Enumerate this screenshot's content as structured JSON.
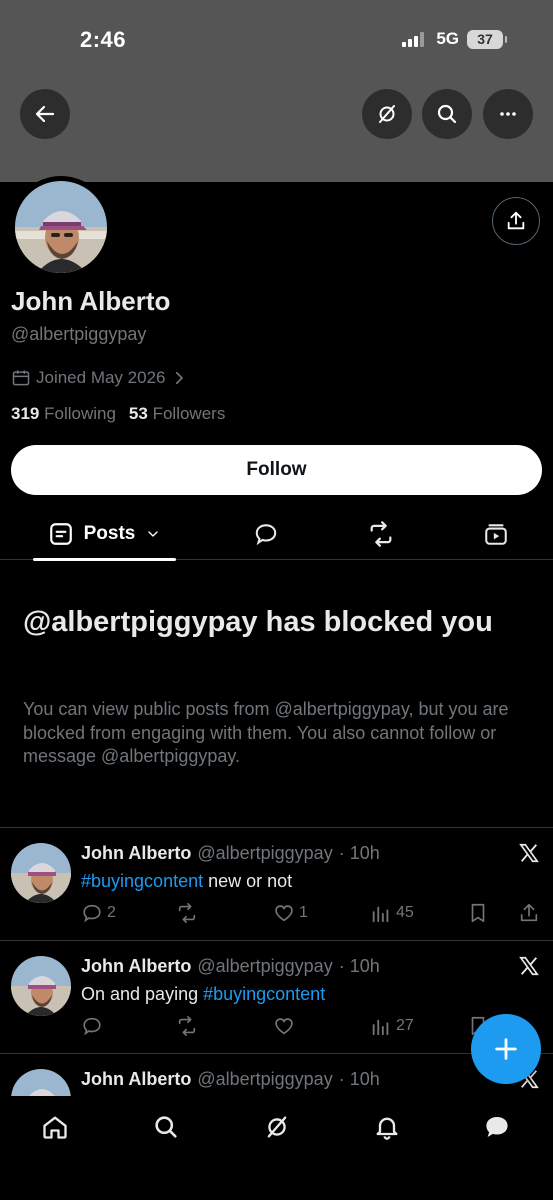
{
  "status": {
    "time": "2:46",
    "network": "5G",
    "battery": "37"
  },
  "profile": {
    "name": "John Alberto",
    "handle": "@albertpiggypay",
    "joined": "Joined May 2026",
    "following_count": "319",
    "following_label": "Following",
    "followers_count": "53",
    "followers_label": "Followers",
    "follow_button": "Follow"
  },
  "tabs": {
    "posts_label": "Posts"
  },
  "blocked": {
    "title": "@albertpiggypay has blocked you",
    "message": "You can view public posts from @albertpiggypay, but you are blocked from engaging with them. You also cannot follow or message @albertpiggypay."
  },
  "tweets": [
    {
      "name": "John Alberto",
      "handle": "@albertpiggypay",
      "time": "· 10h",
      "hashtag": "#buyingcontent",
      "text": " new or not",
      "replies": "2",
      "likes": "1",
      "views": "45"
    },
    {
      "name": "John Alberto",
      "handle": "@albertpiggypay",
      "time": "· 10h",
      "text_prefix": "On and paying ",
      "hashtag": "#buyingcontent",
      "views": "27"
    },
    {
      "name": "John Alberto",
      "handle": "@albertpiggypay",
      "time": "· 10h"
    }
  ],
  "colors": {
    "accent": "#1d9bf0",
    "header_bg": "#555555",
    "muted": "#71767b"
  },
  "icons": [
    "back-arrow-icon",
    "grok-icon",
    "search-icon",
    "more-icon",
    "share-icon",
    "calendar-icon",
    "chevron-right-icon",
    "chevron-down-icon",
    "posts-icon",
    "reply-icon",
    "repost-icon",
    "media-icon",
    "x-logo-icon",
    "like-icon",
    "views-icon",
    "bookmark-icon",
    "plus-icon",
    "home-icon",
    "bell-icon",
    "messages-icon"
  ]
}
